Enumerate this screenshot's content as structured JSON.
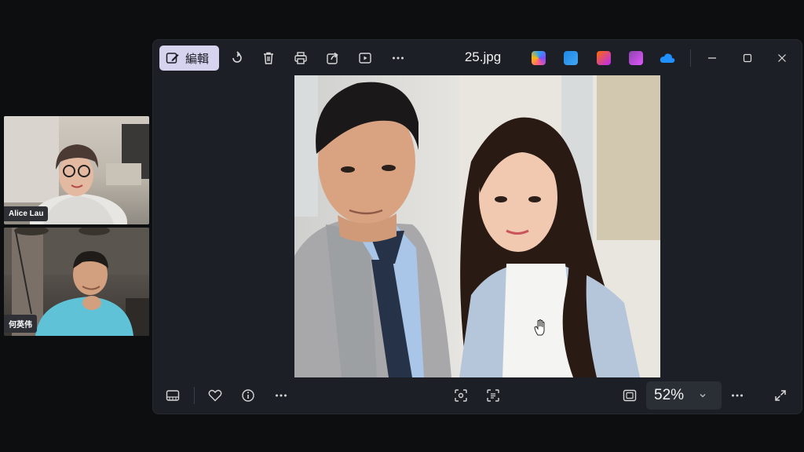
{
  "participants": [
    {
      "name": "Alice Lau"
    },
    {
      "name": "何英伟"
    }
  ],
  "viewer": {
    "edit_label": "編輯",
    "file_name": "25.jpg",
    "zoom": "52%"
  },
  "colors": {
    "background": "#0d0e10",
    "window": "#1c2026",
    "edit_button": "#d6d3ee",
    "name_tag": "#2e3036"
  },
  "icons": {
    "toolbar": [
      "edit-icon",
      "rotate-icon",
      "delete-icon",
      "print-icon",
      "share-icon",
      "slideshow-icon",
      "more-icon"
    ],
    "apps": [
      "copilot-icon",
      "designer-icon",
      "clipchamp-icon",
      "photos-icon",
      "onedrive-icon"
    ],
    "window": [
      "minimize-icon",
      "maximize-icon",
      "close-icon"
    ],
    "bottom": [
      "filmstrip-icon",
      "favorite-icon",
      "info-icon",
      "more-icon",
      "visual-search-icon",
      "text-scan-icon",
      "fit-screen-icon",
      "chevron-down-icon",
      "more-icon",
      "fullscreen-icon"
    ]
  }
}
